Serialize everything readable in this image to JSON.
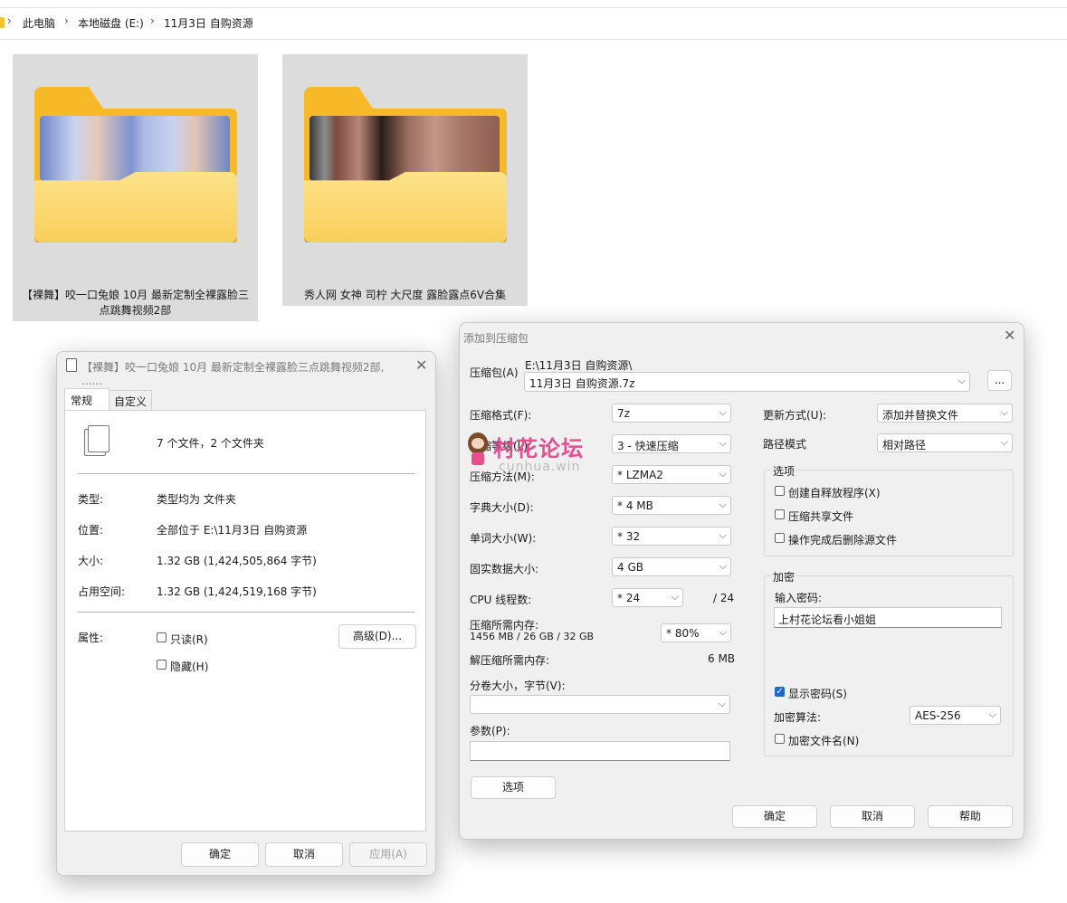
{
  "breadcrumb": {
    "items": [
      "此电脑",
      "本地磁盘 (E:)",
      "11月3日 自购资源"
    ],
    "separator": "›"
  },
  "folders": [
    {
      "line1": "【裸舞】咬一口兔娘 10月 最新定制全裸露脸三",
      "line2": "点跳舞视频2部"
    },
    {
      "line1": "秀人网 女神 司柠 大尺度 露脸露点6V合集",
      "line2": ""
    }
  ],
  "properties_dialog": {
    "title": "【裸舞】咬一口兔娘 10月 最新定制全裸露脸三点跳舞视频2部, ......",
    "tabs": [
      "常规",
      "自定义"
    ],
    "summary": "7 个文件，2 个文件夹",
    "rows": [
      {
        "label": "类型:",
        "value": "类型均为 文件夹"
      },
      {
        "label": "位置:",
        "value": "全部位于 E:\\11月3日 自购资源"
      },
      {
        "label": "大小:",
        "value": "1.32 GB (1,424,505,864 字节)"
      },
      {
        "label": "占用空间:",
        "value": "1.32 GB (1,424,519,168 字节)"
      }
    ],
    "attributes_label": "属性:",
    "readonly_label": "只读(R)",
    "hidden_label": "隐藏(H)",
    "advanced_button": "高级(D)...",
    "ok_button": "确定",
    "cancel_button": "取消",
    "apply_button": "应用(A)"
  },
  "archive_dialog": {
    "title": "添加到压缩包",
    "archive_label": "压缩包(A)",
    "archive_path": "E:\\11月3日 自购资源\\",
    "archive_name": "11月3日 自购资源.7z",
    "browse_button": "...",
    "format_label": "压缩格式(F):",
    "format_value": "7z",
    "level_label": "压缩等级(L):",
    "level_value": "3 - 快速压缩",
    "method_label": "压缩方法(M):",
    "method_value": "* LZMA2",
    "dict_label": "字典大小(D):",
    "dict_value": "* 4 MB",
    "word_label": "单词大小(W):",
    "word_value": "* 32",
    "solid_label": "固实数据大小:",
    "solid_value": "4 GB",
    "cpu_label": "CPU 线程数:",
    "cpu_value": "* 24",
    "cpu_total": "/ 24",
    "mem_comp_label": "压缩所需内存:",
    "mem_comp_value": "1456 MB / 26 GB / 32 GB",
    "mem_percent": "* 80%",
    "mem_decomp_label": "解压缩所需内存:",
    "mem_decomp_value": "6 MB",
    "split_label": "分卷大小，字节(V):",
    "split_value": "",
    "params_label": "参数(P):",
    "params_value": "",
    "options_button": "选项",
    "update_label": "更新方式(U):",
    "update_value": "添加并替换文件",
    "pathmode_label": "路径模式",
    "pathmode_value": "相对路径",
    "options_group": "选项",
    "opt_sfx": "创建自释放程序(X)",
    "opt_shared": "压缩共享文件",
    "opt_delete": "操作完成后删除源文件",
    "encrypt_group": "加密",
    "password_label": "输入密码:",
    "password_value": "上村花论坛看小姐姐",
    "show_password": "显示密码(S)",
    "enc_method_label": "加密算法:",
    "enc_method_value": "AES-256",
    "enc_names": "加密文件名(N)",
    "ok_button": "确定",
    "cancel_button": "取消",
    "help_button": "帮助"
  },
  "watermark": {
    "text": "村花论坛",
    "sub": "cunhua.win"
  }
}
